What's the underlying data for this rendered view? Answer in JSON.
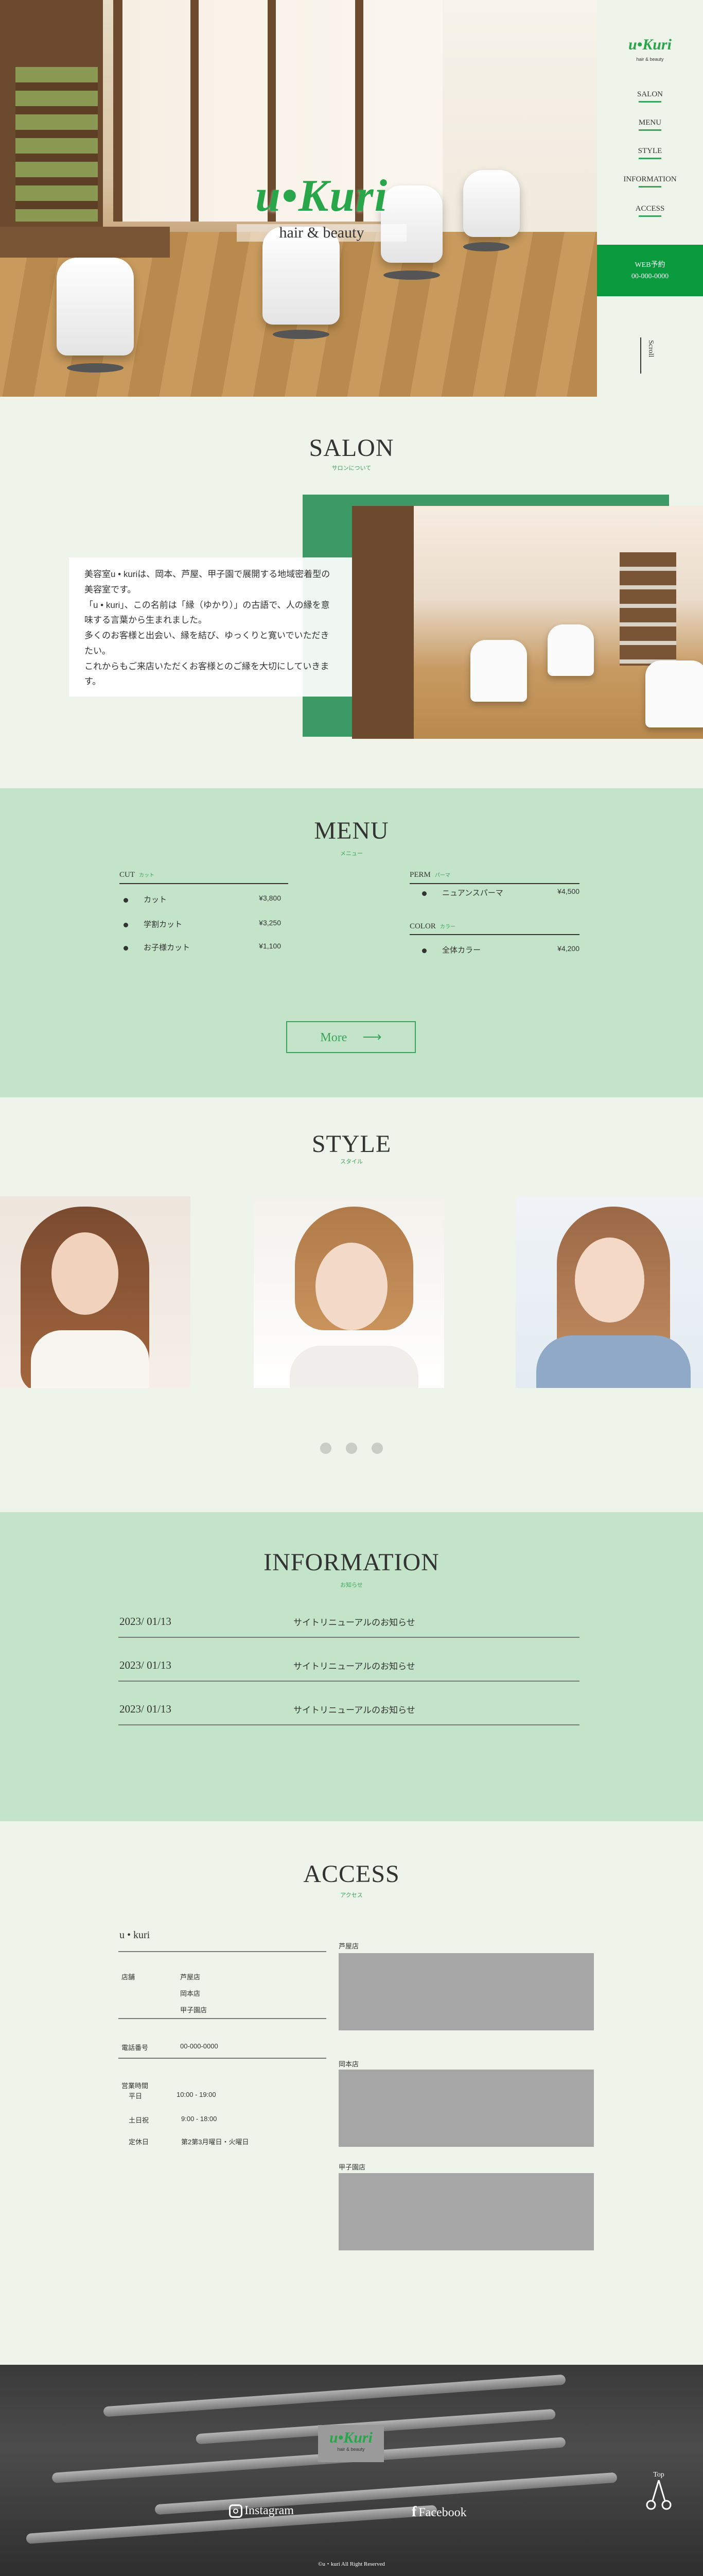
{
  "brand": {
    "logo_main": "u•Kuri",
    "logo_sub": "hair & beauty",
    "accent_color": "#0a9a3e",
    "menu_bg_color": "#c3e4c9",
    "page_bg_color": "#eef4e9"
  },
  "nav": {
    "items": [
      {
        "label": "SALON"
      },
      {
        "label": "MENU"
      },
      {
        "label": "STYLE"
      },
      {
        "label": "INFORMATION"
      },
      {
        "label": "ACCESS"
      }
    ],
    "web_line1": "WEB予約",
    "web_line2": "00-000-0000",
    "scroll_label": "Scroll"
  },
  "salon": {
    "title": "SALON",
    "subtitle": "サロンについて",
    "paragraphs": [
      "美容室u • kuriは、岡本、芦屋、甲子園で展開する地域密着型の美容室です。",
      "「u • kuri」、この名前は「縁（ゆかり）」の古語で、人の縁を意味する言葉から生まれました。",
      "多くのお客様と出会い、縁を結び、ゆっくりと寛いでいただきたい。",
      "これからもご来店いただくお客様とのご縁を大切にしていきます。"
    ]
  },
  "menu": {
    "title": "MENU",
    "subtitle": "メニュー",
    "cut": {
      "label": "CUT",
      "sub": "カット",
      "items": [
        {
          "name": "カット",
          "price": "¥3,800"
        },
        {
          "name": "学割カット",
          "price": "¥3,250"
        },
        {
          "name": "お子様カット",
          "price": "¥1,100"
        }
      ]
    },
    "perm": {
      "label": "PERM",
      "sub": "パーマ",
      "items": [
        {
          "name": "ニュアンスパーマ",
          "price": "¥4,500"
        }
      ]
    },
    "color": {
      "label": "COLOR",
      "sub": "カラー",
      "items": [
        {
          "name": "全体カラー",
          "price": "¥4,200"
        }
      ]
    },
    "more_label": "More",
    "more_arrow": "⟶"
  },
  "style": {
    "title": "STYLE",
    "subtitle": "スタイル",
    "slider_dots": 3
  },
  "information": {
    "title": "INFORMATION",
    "subtitle": "お知らせ",
    "items": [
      {
        "date": "2023/ 01/13",
        "text": "サイトリニューアルのお知らせ"
      },
      {
        "date": "2023/ 01/13",
        "text": "サイトリニューアルのお知らせ"
      },
      {
        "date": "2023/ 01/13",
        "text": "サイトリニューアルのお知らせ"
      }
    ]
  },
  "access": {
    "title": "ACCESS",
    "subtitle": "アクセス",
    "shop_name": "u • kuri",
    "stores_label": "店舗",
    "stores": [
      "芦屋店",
      "岡本店",
      "甲子園店"
    ],
    "phone_label": "電話番号",
    "phone": "00-000-0000",
    "hours_label": "営業時間",
    "weekday_label": "平日",
    "weekday_hours": "10:00 - 19:00",
    "sat_label": "土日祝",
    "sat_hours": "9:00 - 18:00",
    "closed_label": "定休日",
    "closed": "第2第3月曜日・火曜日",
    "maps": [
      {
        "label": "芦屋店"
      },
      {
        "label": "岡本店"
      },
      {
        "label": "甲子園店"
      }
    ]
  },
  "footer": {
    "instagram": "Instagram",
    "facebook": "Facebook",
    "top_label": "Top",
    "copyright": "©u・kuri All Right Reserved"
  }
}
